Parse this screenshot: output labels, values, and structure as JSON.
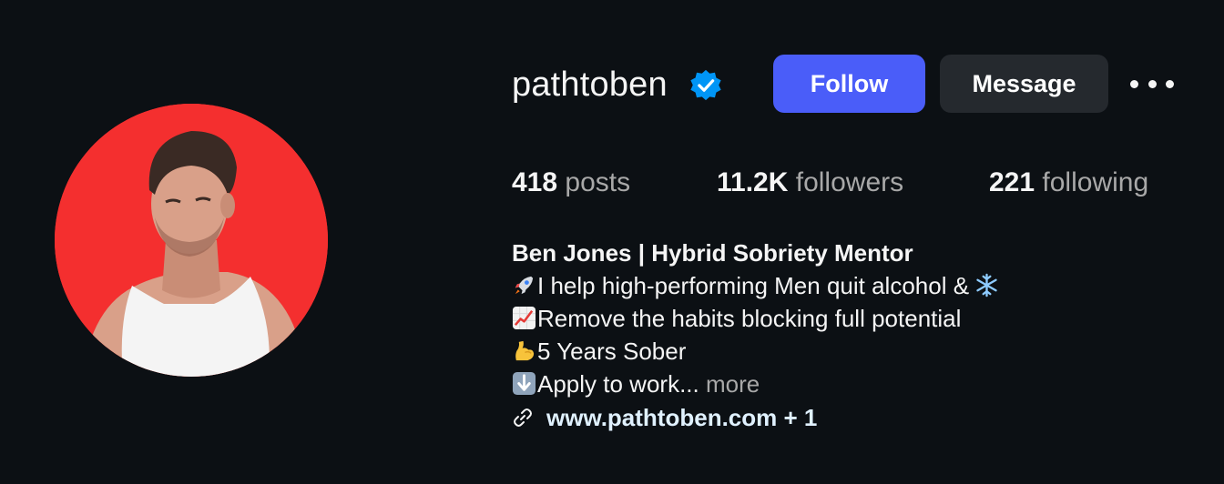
{
  "profile": {
    "username": "pathtoben",
    "verified": true,
    "avatar_bg_color": "#f42f2f"
  },
  "actions": {
    "follow_label": "Follow",
    "message_label": "Message",
    "more_icon": "more-horizontal-icon"
  },
  "stats": {
    "posts_count": "418",
    "posts_label": "posts",
    "followers_count": "11.2K",
    "followers_label": "followers",
    "following_count": "221",
    "following_label": "following"
  },
  "bio": {
    "name": "Ben Jones | Hybrid Sobriety Mentor",
    "lines": [
      {
        "emoji": "rocket",
        "text": "I help high-performing Men quit alcohol &",
        "trailing_emoji": "snowflake"
      },
      {
        "emoji": "chart-increasing",
        "text": "Remove the habits blocking full potential"
      },
      {
        "emoji": "flexed-biceps",
        "text": "5 Years Sober"
      },
      {
        "emoji": "down-arrow",
        "text": "Apply to work...",
        "more_label": "more"
      }
    ]
  },
  "link": {
    "icon": "link-icon",
    "text": "www.pathtoben.com + 1"
  },
  "colors": {
    "background": "#0c1014",
    "follow_button": "#4a5df9",
    "message_button": "#25292e",
    "verified_badge": "#0095f6",
    "secondary_text": "#a8a8a8",
    "link_text": "#e0f1ff"
  }
}
